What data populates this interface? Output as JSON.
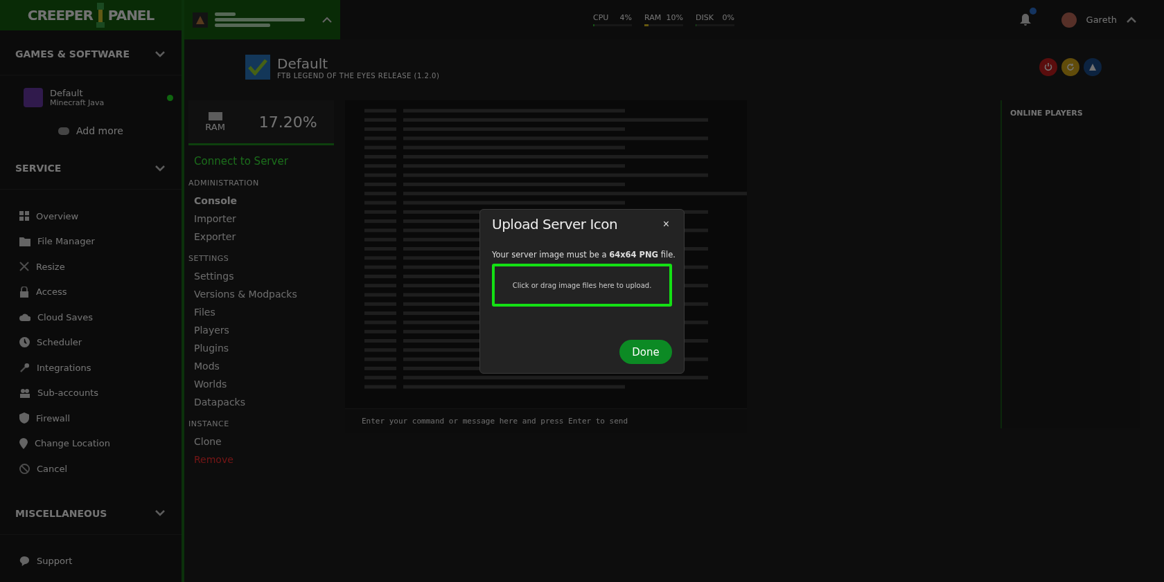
{
  "header": {
    "logo": {
      "left": "CREEPER",
      "right": "PANEL"
    },
    "stats": [
      {
        "label": "CPU",
        "value": "4%",
        "level": 0.04
      },
      {
        "label": "RAM",
        "value": "10%",
        "level": 0.1
      },
      {
        "label": "DISK",
        "value": "0%",
        "level": 0.02
      }
    ],
    "user": {
      "name": "Gareth"
    }
  },
  "sidebar": {
    "sections": [
      {
        "title": "GAMES & SOFTWARE",
        "expanded": true,
        "servers": [
          {
            "name": "Default",
            "game": "Minecraft Java",
            "online": true
          }
        ],
        "add_label": "Add more"
      },
      {
        "title": "SERVICE",
        "expanded": true,
        "items": [
          "Overview",
          "File Manager",
          "Resize",
          "Access",
          "Cloud Saves",
          "Scheduler",
          "Integrations",
          "Sub-accounts",
          "Firewall",
          "Change Location",
          "Cancel"
        ]
      },
      {
        "title": "MISCELLANEOUS",
        "expanded": true,
        "items": [
          "Support"
        ]
      }
    ]
  },
  "server": {
    "name": "Default",
    "subtitle": "FTB LEGEND OF THE EYES RELEASE (1.2.0)"
  },
  "nav": {
    "ram_label": "RAM",
    "ram_value": "17.20%",
    "connect": "Connect to Server",
    "groups": [
      {
        "title": "ADMINISTRATION",
        "items": [
          {
            "label": "Console",
            "selected": true,
            "kind": "normal"
          },
          {
            "label": "Importer",
            "selected": false,
            "kind": "normal"
          },
          {
            "label": "Exporter",
            "selected": false,
            "kind": "normal"
          }
        ]
      },
      {
        "title": "SETTINGS",
        "items": [
          {
            "label": "Settings",
            "selected": false,
            "kind": "normal"
          },
          {
            "label": "Versions & Modpacks",
            "selected": false,
            "kind": "normal"
          },
          {
            "label": "Files",
            "selected": false,
            "kind": "normal"
          },
          {
            "label": "Players",
            "selected": false,
            "kind": "normal"
          },
          {
            "label": "Plugins",
            "selected": false,
            "kind": "normal"
          },
          {
            "label": "Mods",
            "selected": false,
            "kind": "normal"
          },
          {
            "label": "Worlds",
            "selected": false,
            "kind": "normal"
          },
          {
            "label": "Datapacks",
            "selected": false,
            "kind": "normal"
          }
        ]
      },
      {
        "title": "INSTANCE",
        "items": [
          {
            "label": "Clone",
            "selected": false,
            "kind": "normal"
          },
          {
            "label": "Remove",
            "selected": false,
            "kind": "danger"
          }
        ]
      }
    ]
  },
  "console": {
    "placeholder": "Enter your command or message here and press Enter to send"
  },
  "players": {
    "title": "ONLINE PLAYERS"
  },
  "dialog": {
    "title": "Upload Server Icon",
    "close": "×",
    "message": "Your server image must be a **64x64 PNG** file.",
    "dropzone": "Click or drag image files here to upload.",
    "button": "Done"
  }
}
